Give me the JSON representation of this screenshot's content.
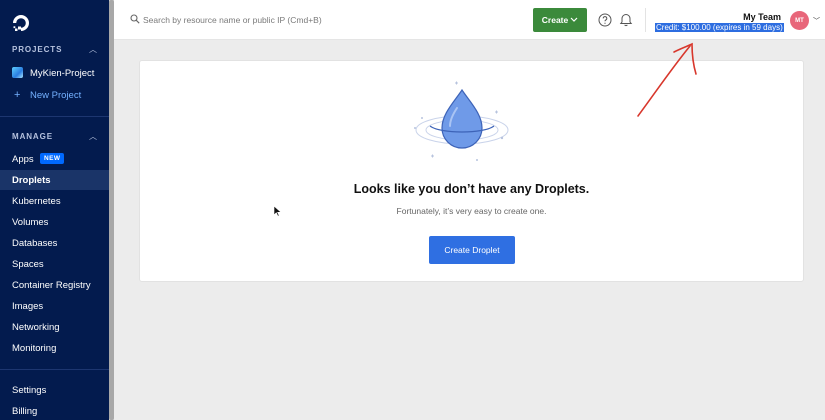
{
  "sidebar": {
    "projects_heading": "PROJECTS",
    "project_name": "MyKien-Project",
    "new_project": "New Project",
    "manage_heading": "MANAGE",
    "items": [
      {
        "label": "Apps"
      },
      {
        "label": "Droplets"
      },
      {
        "label": "Kubernetes"
      },
      {
        "label": "Volumes"
      },
      {
        "label": "Databases"
      },
      {
        "label": "Spaces"
      },
      {
        "label": "Container Registry"
      },
      {
        "label": "Images"
      },
      {
        "label": "Networking"
      },
      {
        "label": "Monitoring"
      }
    ],
    "apps_badge": "NEW",
    "active_item": "Droplets",
    "footer_items": [
      {
        "label": "Settings"
      },
      {
        "label": "Billing"
      }
    ]
  },
  "topbar": {
    "search_placeholder": "Search by resource name or public IP (Cmd+B)",
    "create_label": "Create",
    "team_name": "My Team",
    "credit": "Credit: $100.00 (expires in 59 days)",
    "avatar_initials": "MT"
  },
  "main": {
    "empty_title": "Looks like you don’t have any Droplets.",
    "empty_subtitle": "Fortunately, it’s very easy to create one.",
    "create_droplet_label": "Create Droplet"
  },
  "colors": {
    "sidebar_bg": "#031b4e",
    "create_btn": "#3b8a3b",
    "primary_btn": "#2f6fe2",
    "annotation": "#d8372c",
    "credit_highlight": "#2d6de0"
  }
}
